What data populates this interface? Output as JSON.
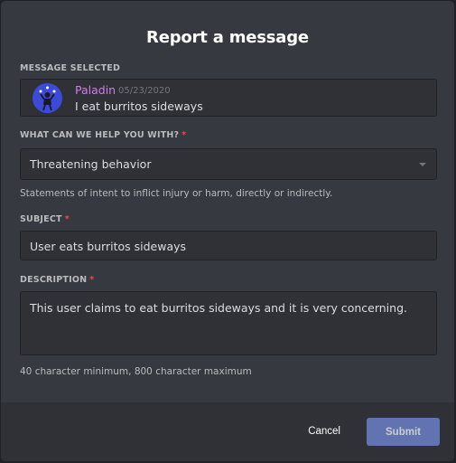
{
  "modal": {
    "title": "Report a message"
  },
  "message_section": {
    "label": "MESSAGE SELECTED",
    "author": "Paladin",
    "date": "05/23/2020",
    "text": "I eat burritos sideways",
    "avatar_icon": "juggler-avatar-icon"
  },
  "reason": {
    "label": "WHAT CAN WE HELP YOU WITH?",
    "required_marker": "*",
    "selected": "Threatening behavior",
    "hint": "Statements of intent to inflict injury or harm, directly or indirectly."
  },
  "subject": {
    "label": "SUBJECT",
    "required_marker": "*",
    "value": "User eats burritos sideways"
  },
  "description": {
    "label": "DESCRIPTION",
    "required_marker": "*",
    "value": "This user claims to eat burritos sideways and it is very concerning.",
    "hint": "40 character minimum, 800 character maximum"
  },
  "footer": {
    "cancel_label": "Cancel",
    "submit_label": "Submit"
  },
  "colors": {
    "background": "#36393f",
    "footer": "#2f3136",
    "accent": "#7289da",
    "author": "#d678f0",
    "required": "#f04747"
  }
}
